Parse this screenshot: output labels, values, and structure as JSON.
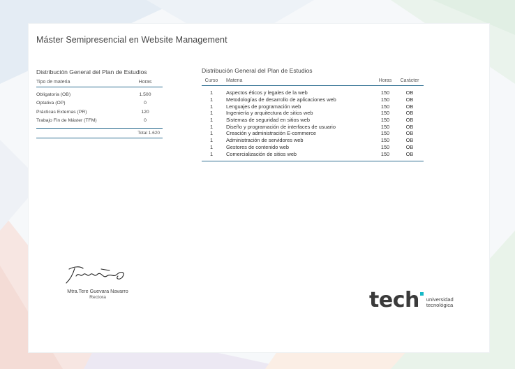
{
  "document": {
    "title": "Máster Semipresencial en Website Management"
  },
  "left_table": {
    "section_title": "Distribución General del Plan de Estudios",
    "col_tipo": "Tipo de materia",
    "col_horas": "Horas",
    "rows": [
      {
        "tipo": "Obligatoria (OB)",
        "horas": "1.500"
      },
      {
        "tipo": "Optativa (OP)",
        "horas": "0"
      },
      {
        "tipo": "Prácticas Externas (PR)",
        "horas": "120"
      },
      {
        "tipo": "Trabajo Fin de Máster (TFM)",
        "horas": "0"
      }
    ],
    "total": "Total 1.620"
  },
  "right_table": {
    "section_title": "Distribución General del Plan de Estudios",
    "col_curso": "Curso",
    "col_materia": "Materia",
    "col_horas": "Horas",
    "col_caracter": "Carácter",
    "rows": [
      {
        "curso": "1",
        "materia": "Aspectos éticos y legales de la web",
        "horas": "150",
        "caracter": "OB"
      },
      {
        "curso": "1",
        "materia": "Metodologías de desarrollo de aplicaciones web",
        "horas": "150",
        "caracter": "OB"
      },
      {
        "curso": "1",
        "materia": "Lenguajes de programación web",
        "horas": "150",
        "caracter": "OB"
      },
      {
        "curso": "1",
        "materia": "Ingeniería y arquitectura de sitios web",
        "horas": "150",
        "caracter": "OB"
      },
      {
        "curso": "1",
        "materia": "Sistemas de seguridad en sitios web",
        "horas": "150",
        "caracter": "OB"
      },
      {
        "curso": "1",
        "materia": "Diseño y programación de interfaces de usuario",
        "horas": "150",
        "caracter": "OB"
      },
      {
        "curso": "1",
        "materia": "Creación y administración E-commerce",
        "horas": "150",
        "caracter": "OB"
      },
      {
        "curso": "1",
        "materia": "Administración de servidores web",
        "horas": "150",
        "caracter": "OB"
      },
      {
        "curso": "1",
        "materia": "Gestores de contenido web",
        "horas": "150",
        "caracter": "OB"
      },
      {
        "curso": "1",
        "materia": "Comercialización de sitios web",
        "horas": "150",
        "caracter": "OB"
      }
    ]
  },
  "signature": {
    "name": "Mtra.Tere Guevara Navarro",
    "role": "Rectora"
  },
  "logo": {
    "word": "tech",
    "line1": "universidad",
    "line2": "tecnológica"
  },
  "colors": {
    "rule": "#2f6f92",
    "logo_accent": "#17b9c7"
  }
}
